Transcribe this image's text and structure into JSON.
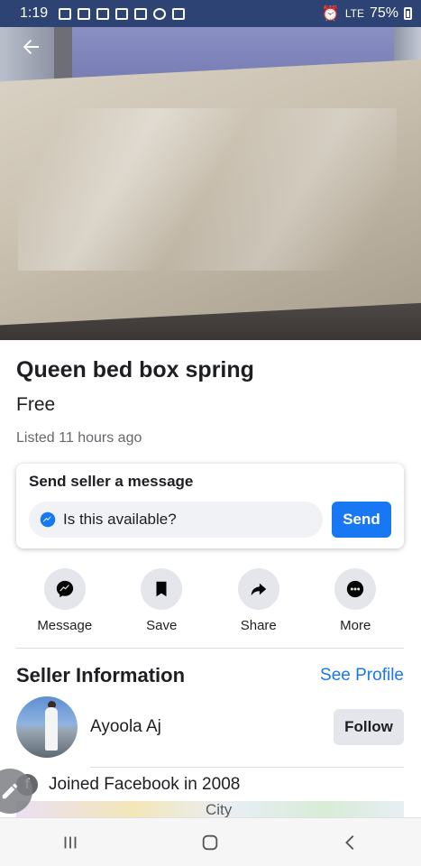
{
  "status_bar": {
    "time": "1:19",
    "signal": "LTE",
    "battery": "75%"
  },
  "listing": {
    "title": "Queen bed box spring",
    "price": "Free",
    "listed": "Listed 11 hours ago"
  },
  "message_card": {
    "title": "Send seller a message",
    "input_value": "Is this available?",
    "send_label": "Send"
  },
  "actions": [
    {
      "label": "Message",
      "icon": "messenger-icon"
    },
    {
      "label": "Save",
      "icon": "bookmark-icon"
    },
    {
      "label": "Share",
      "icon": "share-arrow-icon"
    },
    {
      "label": "More",
      "icon": "more-dots-icon"
    }
  ],
  "seller": {
    "section_title": "Seller Information",
    "see_profile": "See Profile",
    "name": "Ayoola Aj",
    "follow_label": "Follow",
    "joined": "Joined Facebook in 2008",
    "map_label": "City"
  },
  "colors": {
    "accent": "#1877f2",
    "status_bar": "#2d4373"
  }
}
